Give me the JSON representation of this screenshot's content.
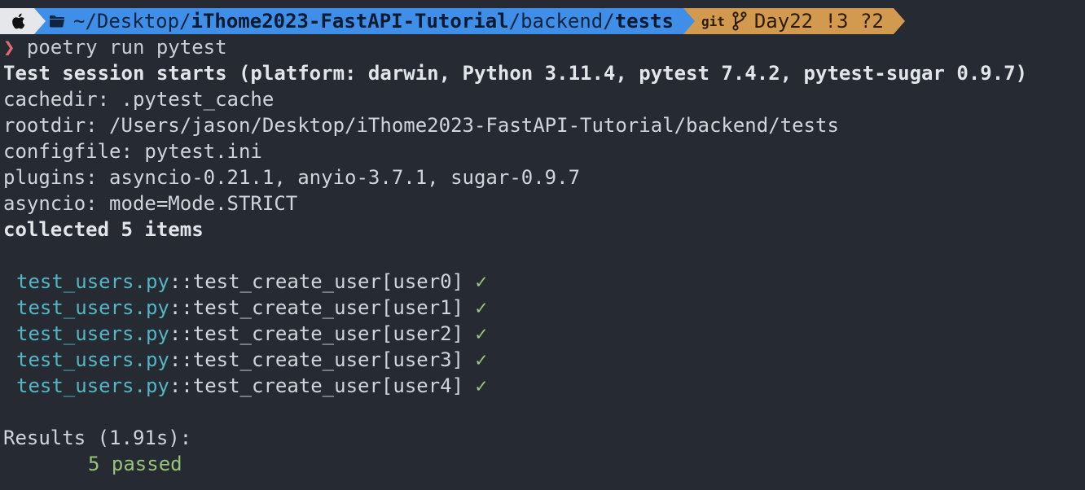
{
  "prompt": {
    "os_icon": "apple-icon",
    "folder_icon": "folder-icon",
    "path_prefix": "~/Desktop/",
    "path_repo": "iThome2023-FastAPI-Tutorial",
    "path_sep": "/backend/",
    "path_last": "tests",
    "git_label": "git",
    "branch_icon": "branch-icon",
    "branch_status": "Day22 !3 ?2",
    "colors": {
      "os_bg": "#e5e7eb",
      "dir_bg": "#3f8ee8",
      "git_bg": "#d19a4f"
    }
  },
  "command": {
    "prompt_char": "❯",
    "text": " poetry run pytest"
  },
  "session": {
    "header": "Test session starts (platform: darwin, Python 3.11.4, pytest 7.4.2, pytest-sugar 0.9.7)",
    "cachedir": "cachedir: .pytest_cache",
    "rootdir": "rootdir: /Users/jason/Desktop/iThome2023-FastAPI-Tutorial/backend/tests",
    "configfile": "configfile: pytest.ini",
    "plugins": "plugins: asyncio-0.21.1, anyio-3.7.1, sugar-0.9.7",
    "asyncio": "asyncio: mode=Mode.STRICT",
    "collected": "collected 5 items"
  },
  "tests": [
    {
      "file": "test_users.py",
      "name": "::test_create_user[user0]",
      "status": "✓"
    },
    {
      "file": "test_users.py",
      "name": "::test_create_user[user1]",
      "status": "✓"
    },
    {
      "file": "test_users.py",
      "name": "::test_create_user[user2]",
      "status": "✓"
    },
    {
      "file": "test_users.py",
      "name": "::test_create_user[user3]",
      "status": "✓"
    },
    {
      "file": "test_users.py",
      "name": "::test_create_user[user4]",
      "status": "✓"
    }
  ],
  "results": {
    "label": "Results (1.91s):",
    "passed": "5 passed"
  }
}
